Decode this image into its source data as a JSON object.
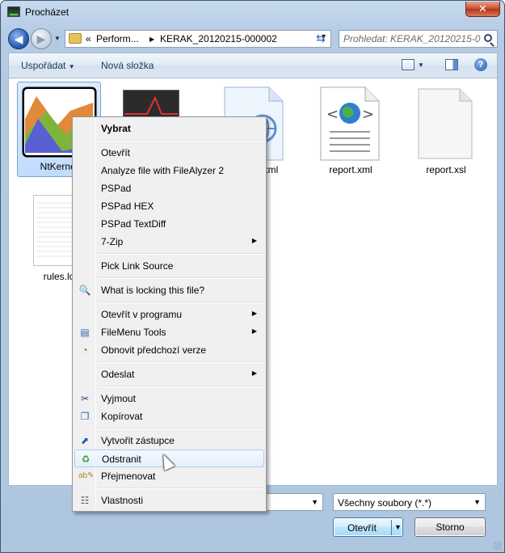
{
  "window": {
    "title": "Procházet",
    "close_glyph": "✕"
  },
  "nav": {
    "back_glyph": "◀",
    "forward_glyph": "▶",
    "breadcrumb_prefix": "«",
    "breadcrumbs": [
      "Perform...",
      "KERAK_20120215-000002"
    ],
    "crumb_sep": "▶",
    "search_placeholder": "Prohledat: KERAK_20120215-0..."
  },
  "toolbar": {
    "organize_label": "Uspořádat",
    "organize_arrow": "▼",
    "new_folder_label": "Nová složka",
    "help_glyph": "?"
  },
  "files": [
    {
      "name": "NtKernel",
      "type": "chart-image",
      "selected": true
    },
    {
      "name": "",
      "type": "graph-image"
    },
    {
      "name": "...xml",
      "type": "web-document"
    },
    {
      "name": "report.xml",
      "type": "xml-document"
    },
    {
      "name": "report.xsl",
      "type": "blank-document"
    },
    {
      "name": "rules.lo...",
      "type": "text-document"
    }
  ],
  "context_menu": {
    "items": [
      {
        "label": "Vybrat",
        "bold": true
      },
      {
        "separator": true
      },
      {
        "label": "Otevřít"
      },
      {
        "label": "Analyze file with FileAlyzer 2"
      },
      {
        "label": "PSPad"
      },
      {
        "label": "PSPad HEX"
      },
      {
        "label": "PSPad TextDiff"
      },
      {
        "label": "7-Zip",
        "submenu": true
      },
      {
        "separator": true
      },
      {
        "label": "Pick Link Source"
      },
      {
        "separator": true
      },
      {
        "label": "What is locking this file?",
        "icon": "magnifier-gear-icon"
      },
      {
        "separator": true
      },
      {
        "label": "Otevřít v programu",
        "submenu": true
      },
      {
        "label": "FileMenu Tools",
        "submenu": true,
        "icon": "filemenu-tools-icon"
      },
      {
        "label": "Obnovit předchozí verze",
        "icon": "restore-versions-icon"
      },
      {
        "separator": true
      },
      {
        "label": "Odeslat",
        "submenu": true
      },
      {
        "separator": true
      },
      {
        "label": "Vyjmout",
        "icon": "scissors-icon"
      },
      {
        "label": "Kopírovat",
        "icon": "copy-icon"
      },
      {
        "separator": true
      },
      {
        "label": "Vytvořit zástupce",
        "icon": "shortcut-icon"
      },
      {
        "label": "Odstranit",
        "icon": "recycle-bin-icon",
        "hovered": true
      },
      {
        "label": "Přejmenovat",
        "icon": "rename-icon"
      },
      {
        "separator": true
      },
      {
        "label": "Vlastnosti",
        "icon": "properties-icon"
      }
    ],
    "submenu_glyph": "▶"
  },
  "footer": {
    "file_type_filter": "Všechny soubory (*.*)",
    "dropdown_glyph": "▼",
    "open_label": "Otevřít",
    "cancel_label": "Storno"
  },
  "colors": {
    "selection": "#c1dcfc",
    "accent": "#2b62ba",
    "menu_bg": "#f0f0f0"
  }
}
